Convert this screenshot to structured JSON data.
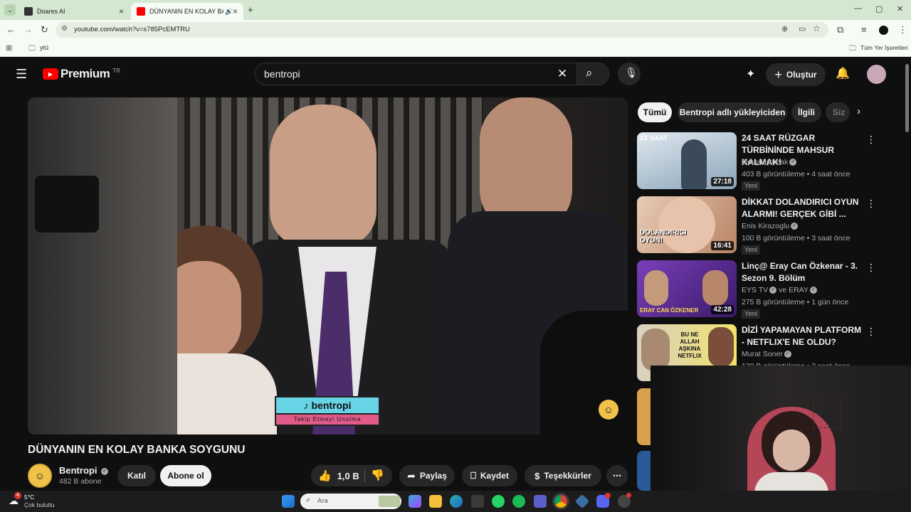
{
  "browser": {
    "tabs": [
      {
        "title": "Doares AI"
      },
      {
        "title": "DÜNYANIN EN KOLAY BANKA"
      }
    ],
    "url": "youtube.com/watch?v=s785PcEMTRU",
    "bookmarks": [
      {
        "label": "ytü"
      }
    ],
    "all_bookmarks": "Tüm Yer İşaretleri"
  },
  "youtube": {
    "logo_text": "Premium",
    "logo_region": "TR",
    "search_value": "bentropi",
    "create_label": "Oluştur",
    "video": {
      "title": "DÜNYANIN EN KOLAY BANKA SOYGUNU",
      "overlay_handle": "bentropi",
      "overlay_tagline": "Takip Etmeyi Unutma",
      "channel_name": "Bentropi",
      "subscribers": "482 B abone",
      "join_label": "Katıl",
      "subscribe_label": "Abone ol",
      "likes": "1,0 B",
      "share_label": "Paylaş",
      "save_label": "Kaydet",
      "thanks_label": "Teşekkürler"
    },
    "chips": [
      {
        "label": "Tümü",
        "active": true
      },
      {
        "label": "Bentropi adlı yükleyiciden",
        "active": false
      },
      {
        "label": "İlgili",
        "active": false
      },
      {
        "label": "Siz",
        "active": false
      }
    ],
    "recommendations": [
      {
        "title": "24 SAAT RÜZGAR TÜRBİNİNDE MAHSUR KALMAK!",
        "channel": "Orkun Işıtmak",
        "meta": "403 B görüntüleme • 4 saat önce",
        "badge": "Yeni",
        "duration": "27:18",
        "thumb_text": "23. SAAT",
        "thumb_color": "#9ab6c9"
      },
      {
        "title": "DİKKAT DOLANDIRICI OYUN ALARMI! GERÇEK GİBİ ...",
        "channel": "Enis Kirazoglu",
        "meta": "100 B görüntüleme • 3 saat önce",
        "badge": "Yeni",
        "duration": "16:41",
        "thumb_text": "DOLANDIRICI OYUN!",
        "thumb_color": "#c9a48a"
      },
      {
        "title": "Linç@ Eray Can Özkenar - 3. Sezon 9. Bölüm",
        "channel": "EYS TV",
        "channel2": "ve ERAY",
        "meta": "275 B görüntüleme • 1 gün önce",
        "badge": "Yeni",
        "duration": "42:28",
        "thumb_text": "ERAY CAN ÖZKENER",
        "thumb_color": "#6b3fa0"
      },
      {
        "title": "DİZİ YAPAMAYAN PLATFORM - NETFLIX'E NE OLDU?",
        "channel": "Murat Soner",
        "meta": "120 B görüntüleme • 2 saat önce",
        "badge": "",
        "duration": "",
        "thumb_text": "BU NE ALLAH AŞKINA NETFLIX",
        "thumb_color": "#e8d24a"
      }
    ]
  },
  "taskbar": {
    "weather_temp": "5°C",
    "weather_desc": "Çok bulutlu",
    "weather_badge": "4",
    "search_placeholder": "Ara"
  }
}
